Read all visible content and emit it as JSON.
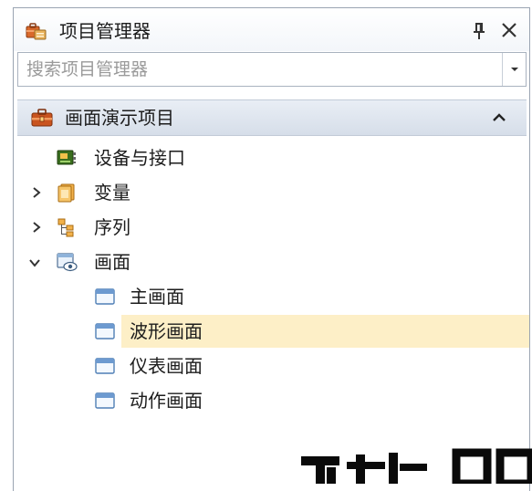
{
  "panel": {
    "title": "项目管理器",
    "title_icon": "briefcase-folder-icon",
    "pin_label": "ᵖ",
    "close_label": "✕"
  },
  "search": {
    "placeholder": "搜索项目管理器",
    "value": "",
    "dropdown_icon": "chevron-down-icon"
  },
  "project": {
    "name": "画面演示项目",
    "icon": "briefcase-icon",
    "collapse_icon": "chevron-up-icon"
  },
  "tree": {
    "items": [
      {
        "label": "设备与接口",
        "icon": "device-board-icon",
        "expander": "none"
      },
      {
        "label": "变量",
        "icon": "variables-stack-icon",
        "expander": "collapsed"
      },
      {
        "label": "序列",
        "icon": "sequence-tree-icon",
        "expander": "collapsed"
      },
      {
        "label": "画面",
        "icon": "screen-eye-icon",
        "expander": "expanded"
      }
    ],
    "screens": [
      {
        "label": "主画面",
        "icon": "window-icon",
        "selected": false
      },
      {
        "label": "波形画面",
        "icon": "window-icon",
        "selected": true
      },
      {
        "label": "仪表画面",
        "icon": "window-icon",
        "selected": false
      },
      {
        "label": "动作画面",
        "icon": "window-icon",
        "selected": false
      }
    ]
  },
  "colors": {
    "selection": "#fdefc7",
    "border": "#9aa4b2",
    "header_bg": "#dfe6ef"
  }
}
